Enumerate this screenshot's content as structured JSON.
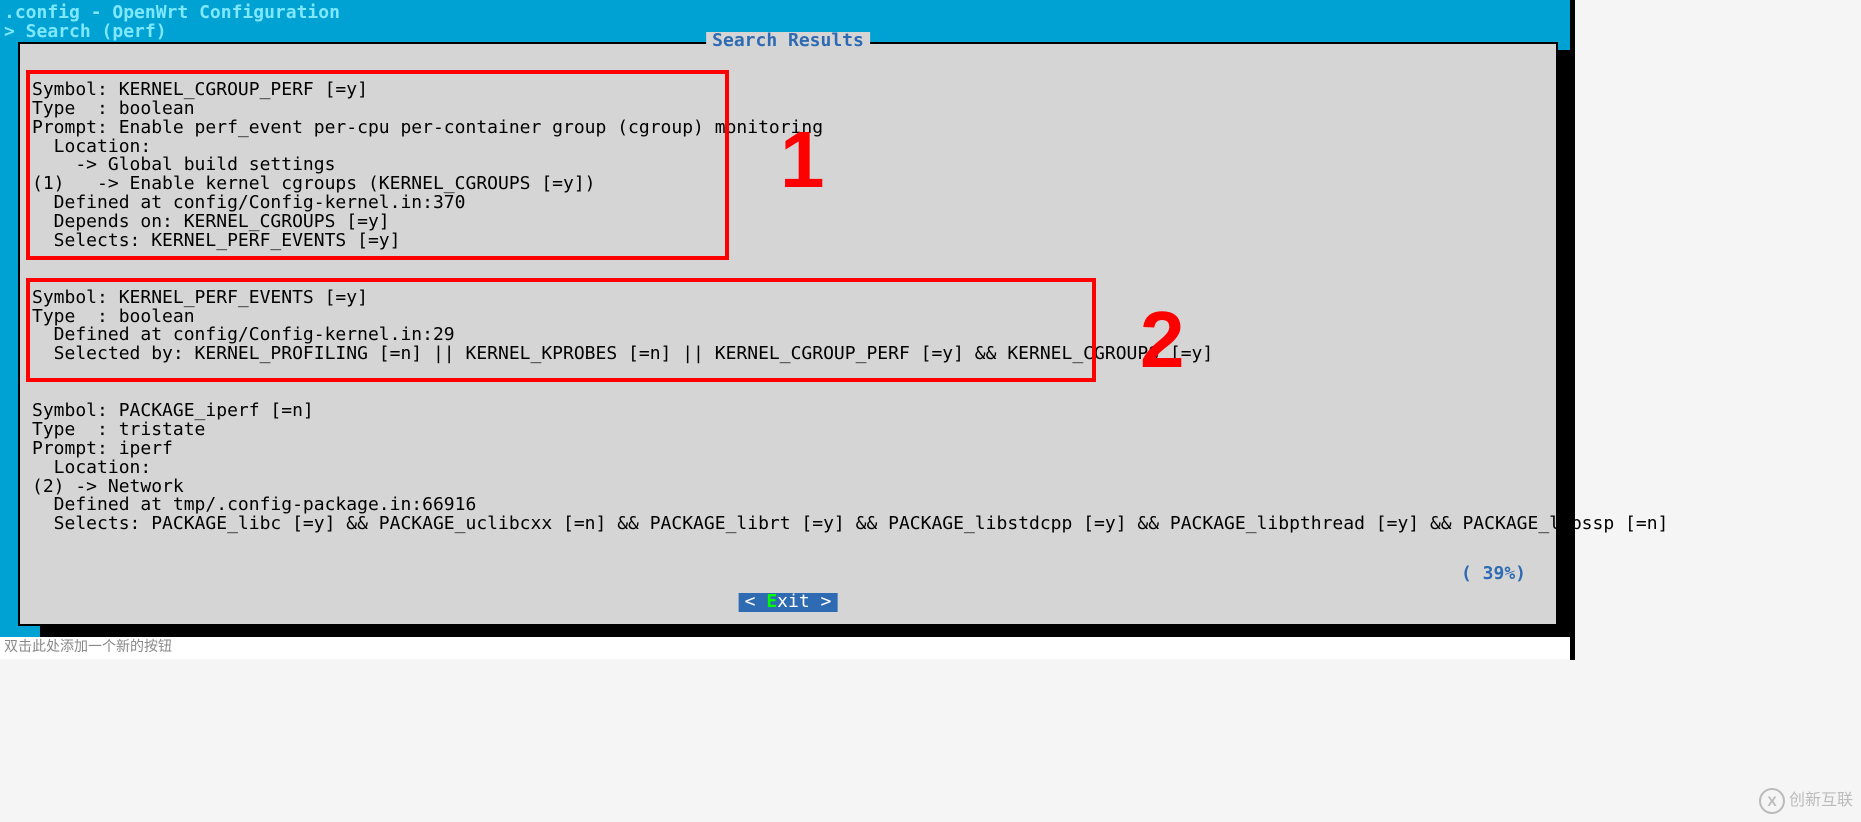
{
  "header": {
    "title": " .config - OpenWrt Configuration",
    "search_line": " > Search (perf) "
  },
  "box": {
    "title": " Search Results ",
    "percent": "( 39%)",
    "exit_label": "xit",
    "exit_prefix": "< ",
    "exit_suffix": " >",
    "exit_hot": "E"
  },
  "sym1": {
    "l1": "Symbol: KERNEL_CGROUP_PERF [=y]",
    "l2": "Type  : boolean",
    "l3": "Prompt: Enable perf_event per-cpu per-container group (cgroup) monitoring",
    "l4": "  Location:",
    "l5": "    -> Global build settings",
    "l6": "(1)   -> Enable kernel cgroups (KERNEL_CGROUPS [=y])",
    "l7": "  Defined at config/Config-kernel.in:370",
    "l8": "  Depends on: KERNEL_CGROUPS [=y]",
    "l9": "  Selects: KERNEL_PERF_EVENTS [=y]"
  },
  "sym2": {
    "l1": "Symbol: KERNEL_PERF_EVENTS [=y]",
    "l2": "Type  : boolean",
    "l3": "  Defined at config/Config-kernel.in:29",
    "l4": "  Selected by: KERNEL_PROFILING [=n] || KERNEL_KPROBES [=n] || KERNEL_CGROUP_PERF [=y] && KERNEL_CGROUPS [=y]"
  },
  "sym3": {
    "l1": "Symbol: PACKAGE_iperf [=n]",
    "l2": "Type  : tristate",
    "l3": "Prompt: iperf",
    "l4": "  Location:",
    "l5": "(2) -> Network",
    "l6": "  Defined at tmp/.config-package.in:66916",
    "l7": "  Selects: PACKAGE_libc [=y] && PACKAGE_uclibcxx [=n] && PACKAGE_librt [=y] && PACKAGE_libstdcpp [=y] && PACKAGE_libpthread [=y] && PACKAGE_libssp [=n]"
  },
  "annotations": {
    "num1": "1",
    "num2": "2"
  },
  "bottom_hint": "双击此处添加一个新的按钮",
  "logo_text": "创新互联"
}
